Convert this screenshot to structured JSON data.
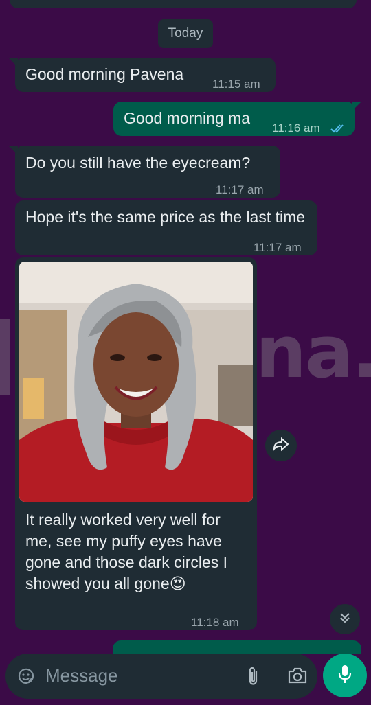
{
  "colors": {
    "background": "#3b0b47",
    "incoming_bubble": "#1f2c34",
    "outgoing_bubble": "#005c4b",
    "accent": "#00a884",
    "read_ticks": "#53bdeb"
  },
  "wallpaper": {
    "text": "na."
  },
  "date_divider": "Today",
  "messages": [
    {
      "direction": "incoming",
      "text": "Good morning Pavena",
      "time": "11:15 am"
    },
    {
      "direction": "outgoing",
      "text": "Good morning ma",
      "time": "11:16 am",
      "status_icon": "double-check-read-icon"
    },
    {
      "direction": "incoming",
      "text": "Do you still have the eyecream?",
      "time": "11:17 am"
    },
    {
      "direction": "incoming",
      "text": "Hope it's the same price as the last time",
      "time": "11:17 am"
    },
    {
      "direction": "incoming",
      "type": "image",
      "caption": "It really worked very well for me, see my puffy eyes have gone and those dark circles I showed you all gone",
      "emoji": "😍",
      "time": "11:18 am"
    }
  ],
  "controls": {
    "forward_icon": "forward-arrow-icon",
    "scroll_down_icon": "double-chevron-down-icon"
  },
  "composer": {
    "placeholder": "Message",
    "emoji_icon": "sticker-emoji-icon",
    "attach_icon": "paperclip-icon",
    "camera_icon": "camera-icon",
    "mic_icon": "microphone-icon"
  }
}
